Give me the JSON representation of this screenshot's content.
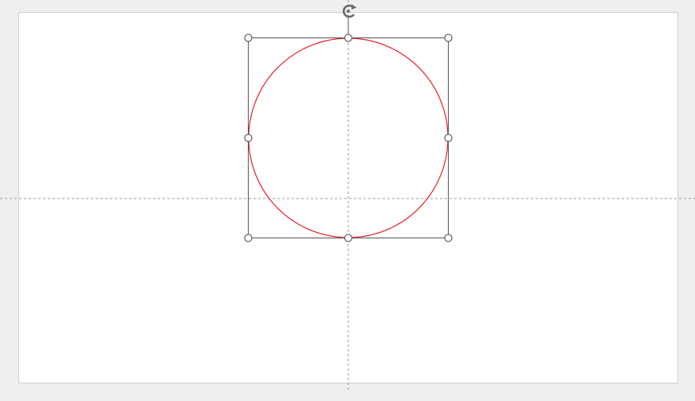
{
  "canvas": {
    "background": "#efefef",
    "slide_background": "#ffffff",
    "slide_border": "#cfcfcf"
  },
  "shape": {
    "type": "circle",
    "stroke_color": "#e8202a",
    "fill": "none",
    "selected": true
  },
  "selection": {
    "frame_color": "#555555",
    "handle_color": "#666666",
    "handle_fill": "#ffffff",
    "rotate_icon": "rotate-handle-icon",
    "handles": [
      "top-left",
      "top-center",
      "top-right",
      "middle-left",
      "middle-right",
      "bottom-left",
      "bottom-center",
      "bottom-right"
    ]
  },
  "guides": {
    "color": "#9a9a9a",
    "style": "dashed",
    "items": [
      "vertical-center",
      "horizontal-center"
    ]
  }
}
